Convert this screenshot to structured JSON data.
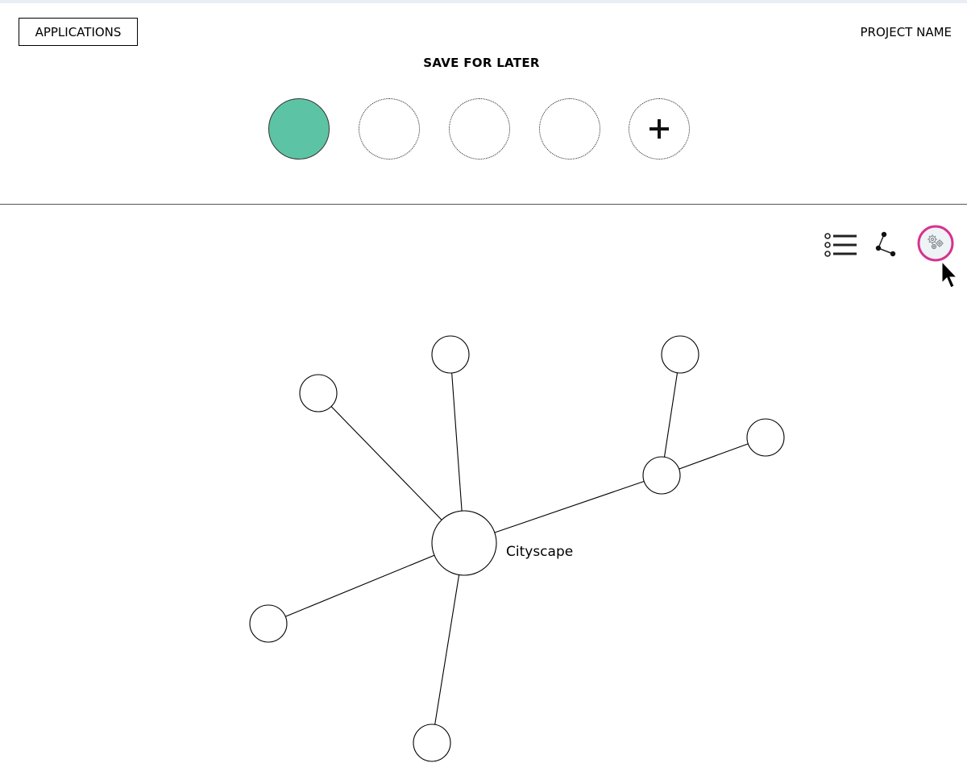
{
  "header": {
    "applications_label": "APPLICATIONS",
    "project_name": "PROJECT NAME"
  },
  "save_for_later": {
    "title": "SAVE FOR LATER",
    "slots": [
      {
        "state": "filled",
        "color": "#5cc4a4"
      },
      {
        "state": "empty"
      },
      {
        "state": "empty"
      },
      {
        "state": "empty"
      },
      {
        "state": "add",
        "icon": "plus-icon"
      }
    ]
  },
  "toolbar": {
    "tools": [
      {
        "name": "list-view",
        "icon": "list-icon"
      },
      {
        "name": "graph-view",
        "icon": "graph-icon"
      },
      {
        "name": "settings",
        "icon": "gears-icon",
        "highlight_color": "#d6338f"
      }
    ]
  },
  "graph": {
    "center_label": "Cityscape"
  }
}
